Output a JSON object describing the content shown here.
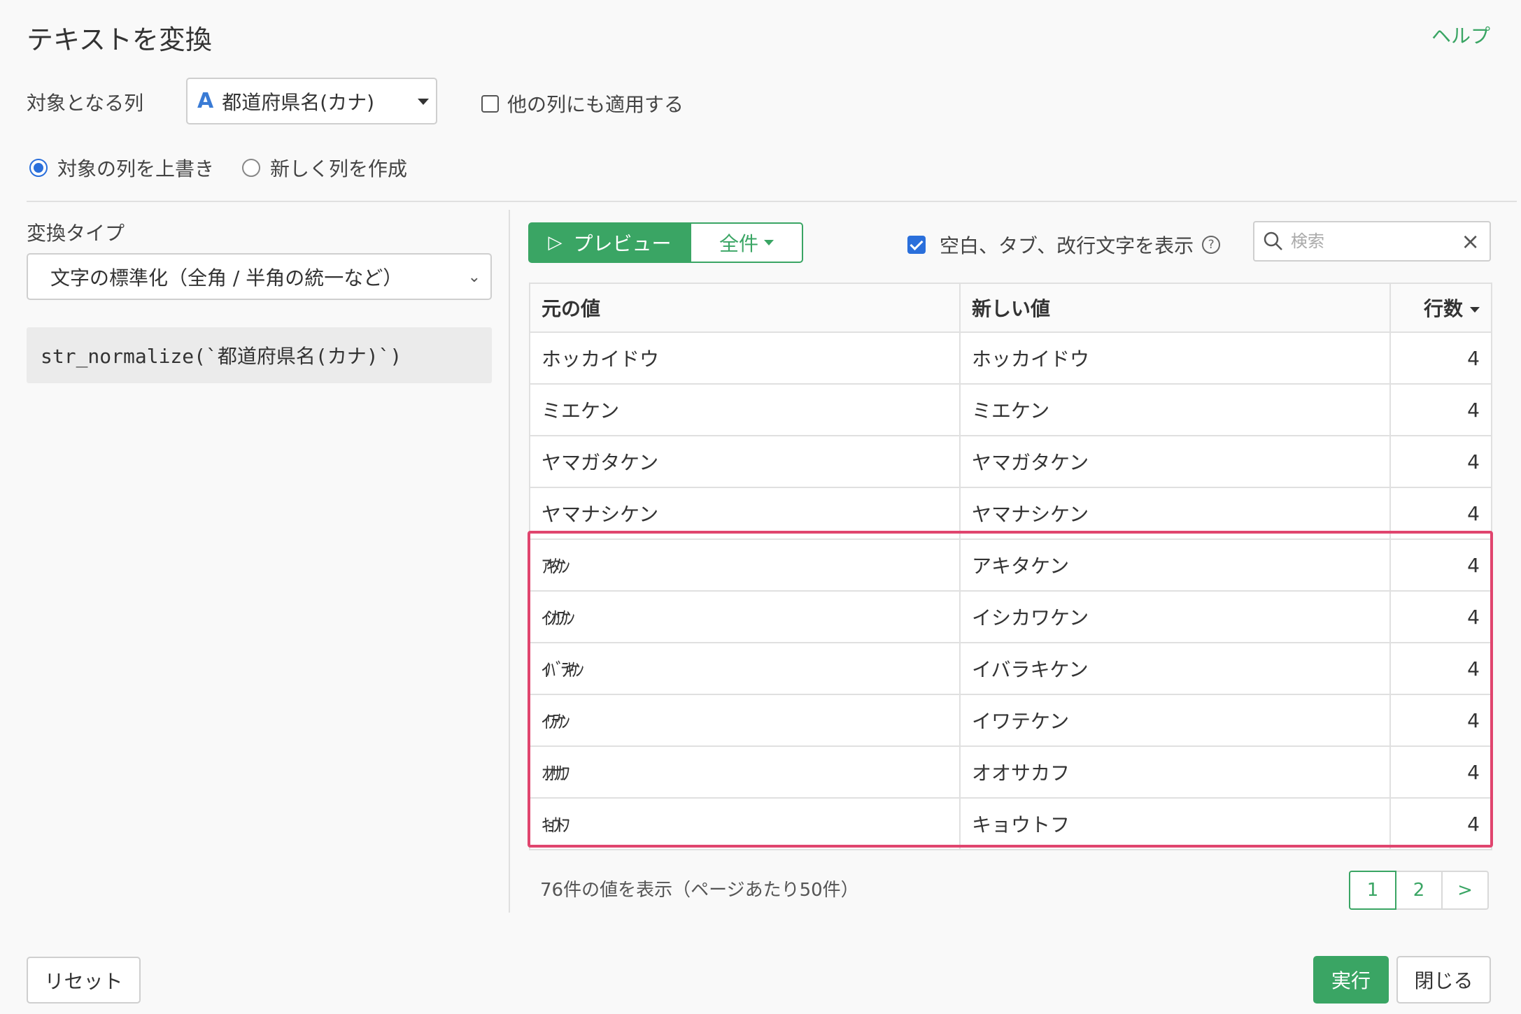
{
  "dialog": {
    "title": "テキストを変換",
    "help_label": "ヘルプ"
  },
  "target": {
    "label": "対象となる列",
    "column_type_icon": "A",
    "column_value": "都道府県名(カナ)",
    "apply_other_label": "他の列にも適用する"
  },
  "output_mode": {
    "overwrite_label": "対象の列を上書き",
    "new_column_label": "新しく列を作成",
    "selected": "overwrite"
  },
  "conversion": {
    "label": "変換タイプ",
    "type_value": "文字の標準化（全角 / 半角の統一など）",
    "expression": "str_normalize(`都道府県名(カナ)`)"
  },
  "preview": {
    "preview_label": "プレビュー",
    "scope_label": "全件",
    "show_whitespace_label": "空白、タブ、改行文字を表示",
    "show_whitespace_checked": true,
    "search_placeholder": "検索"
  },
  "table": {
    "headers": [
      "元の値",
      "新しい値",
      "行数"
    ],
    "rows": [
      {
        "original": "ホッカイドウ",
        "new": "ホッカイドウ",
        "count": "4"
      },
      {
        "original": "ミエケン",
        "new": "ミエケン",
        "count": "4"
      },
      {
        "original": "ヤマガタケン",
        "new": "ヤマガタケン",
        "count": "4"
      },
      {
        "original": "ヤマナシケン",
        "new": "ヤマナシケン",
        "count": "4"
      },
      {
        "original": "ｱｷﾀｹﾝ",
        "new": "アキタケン",
        "count": "4"
      },
      {
        "original": "ｲｼｶﾜｹﾝ",
        "new": "イシカワケン",
        "count": "4"
      },
      {
        "original": "ｲﾊﾞﾗｷｹﾝ",
        "new": "イバラキケン",
        "count": "4"
      },
      {
        "original": "ｲﾜﾃｹﾝ",
        "new": "イワテケン",
        "count": "4"
      },
      {
        "original": "ｵｵｻｶﾌ",
        "new": "オオサカフ",
        "count": "4"
      },
      {
        "original": "ｷｮｳﾄﾌ",
        "new": "キョウトフ",
        "count": "4"
      }
    ],
    "highlight_color": "#e0456e"
  },
  "footer": {
    "summary": "76件の値を表示（ページあたり50件）",
    "pages": [
      "1",
      "2",
      ">"
    ],
    "current_page": "1",
    "reset_label": "リセット",
    "run_label": "実行",
    "close_label": "閉じる"
  },
  "colors": {
    "accent": "#3aa564",
    "checkbox_blue": "#2a6fdb"
  }
}
